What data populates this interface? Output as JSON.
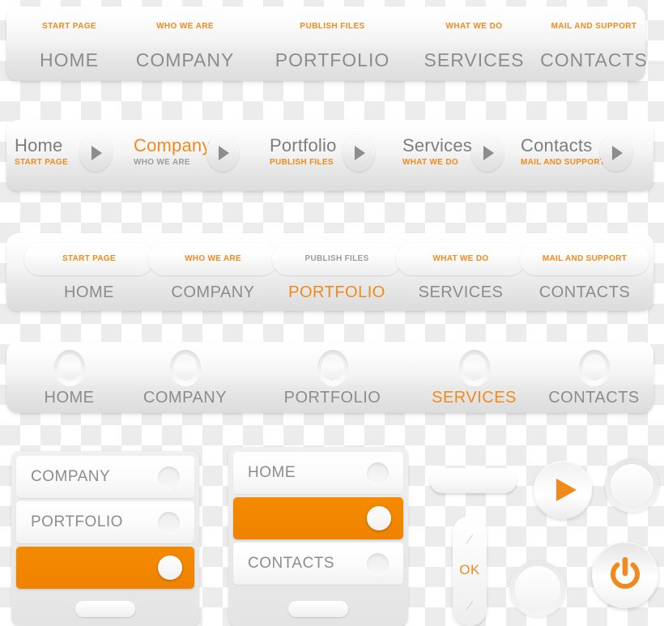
{
  "theme": {
    "accent": "#F08A1C",
    "label_gray": "#8C8C8C",
    "panel_light": "#FFFFFF",
    "panel_shade": "#E4E4E4"
  },
  "navbar_simple": {
    "name": "navbar-simple",
    "items": [
      {
        "subtitle": "START PAGE",
        "label": "HOME",
        "active": false
      },
      {
        "subtitle": "WHO WE ARE",
        "label": "COMPANY",
        "active": false
      },
      {
        "subtitle": "PUBLISH FILES",
        "label": "PORTFOLIO",
        "active": false
      },
      {
        "subtitle": "WHAT WE DO",
        "label": "SERVICES",
        "active": false
      },
      {
        "subtitle": "MAIL AND SUPPORT",
        "label": "CONTACTS",
        "active": false
      }
    ]
  },
  "navbar_arrows": {
    "name": "navbar-arrows",
    "arrow_icon": "play-triangle-icon",
    "items": [
      {
        "label": "Home",
        "subtitle": "START PAGE",
        "active": false
      },
      {
        "label": "Company",
        "subtitle": "WHO WE ARE",
        "active": true
      },
      {
        "label": "Portfolio",
        "subtitle": "PUBLISH FILES",
        "active": false
      },
      {
        "label": "Services",
        "subtitle": "WHAT WE DO",
        "active": false
      },
      {
        "label": "Contacts",
        "subtitle": "MAIL AND SUPPORT",
        "active": false
      }
    ]
  },
  "navbar_pills": {
    "name": "navbar-pills",
    "items": [
      {
        "pill": "START PAGE",
        "label": "HOME",
        "active": false
      },
      {
        "pill": "WHO WE ARE",
        "label": "COMPANY",
        "active": false
      },
      {
        "pill": "PUBLISH FILES",
        "label": "PORTFOLIO",
        "active": true
      },
      {
        "pill": "WHAT WE DO",
        "label": "SERVICES",
        "active": false
      },
      {
        "pill": "MAIL AND SUPPORT",
        "label": "CONTACTS",
        "active": false
      }
    ]
  },
  "navbar_rings": {
    "name": "navbar-rings",
    "ring_icon": "circle-ring-icon",
    "items": [
      {
        "label": "HOME",
        "active": false
      },
      {
        "label": "COMPANY",
        "active": false
      },
      {
        "label": "PORTFOLIO",
        "active": false
      },
      {
        "label": "SERVICES",
        "active": true
      },
      {
        "label": "CONTACTS",
        "active": false
      }
    ]
  },
  "panel_left": {
    "name": "vertical-menu-left",
    "rows": [
      {
        "label": "COMPANY",
        "selected": false,
        "knob_icon": "toggle-knob-icon"
      },
      {
        "label": "PORTFOLIO",
        "selected": false,
        "knob_icon": "toggle-knob-icon"
      },
      {
        "label": "",
        "selected": true,
        "knob_icon": "toggle-knob-icon"
      }
    ],
    "footer_handle": "drag-handle-pill"
  },
  "panel_right": {
    "name": "vertical-menu-right",
    "rows": [
      {
        "label": "HOME",
        "selected": false,
        "knob_icon": "toggle-knob-icon"
      },
      {
        "label": "",
        "selected": true,
        "knob_icon": "toggle-knob-icon"
      },
      {
        "label": "CONTACTS",
        "selected": false,
        "knob_icon": "toggle-knob-icon"
      }
    ],
    "footer_handle": "drag-handle-pill"
  },
  "widgets": {
    "name": "widget-cluster",
    "blank_pill_label": "",
    "play_button": {
      "icon": "play-icon",
      "label": ""
    },
    "ring_button_top": {
      "icon": "circle-ring-icon",
      "label": ""
    },
    "ok_button": {
      "label": "OK",
      "icon": "ok-slider-icon"
    },
    "ring_button_bottom": {
      "icon": "circle-ring-icon",
      "label": ""
    },
    "power_button": {
      "icon": "power-icon",
      "label": ""
    }
  }
}
